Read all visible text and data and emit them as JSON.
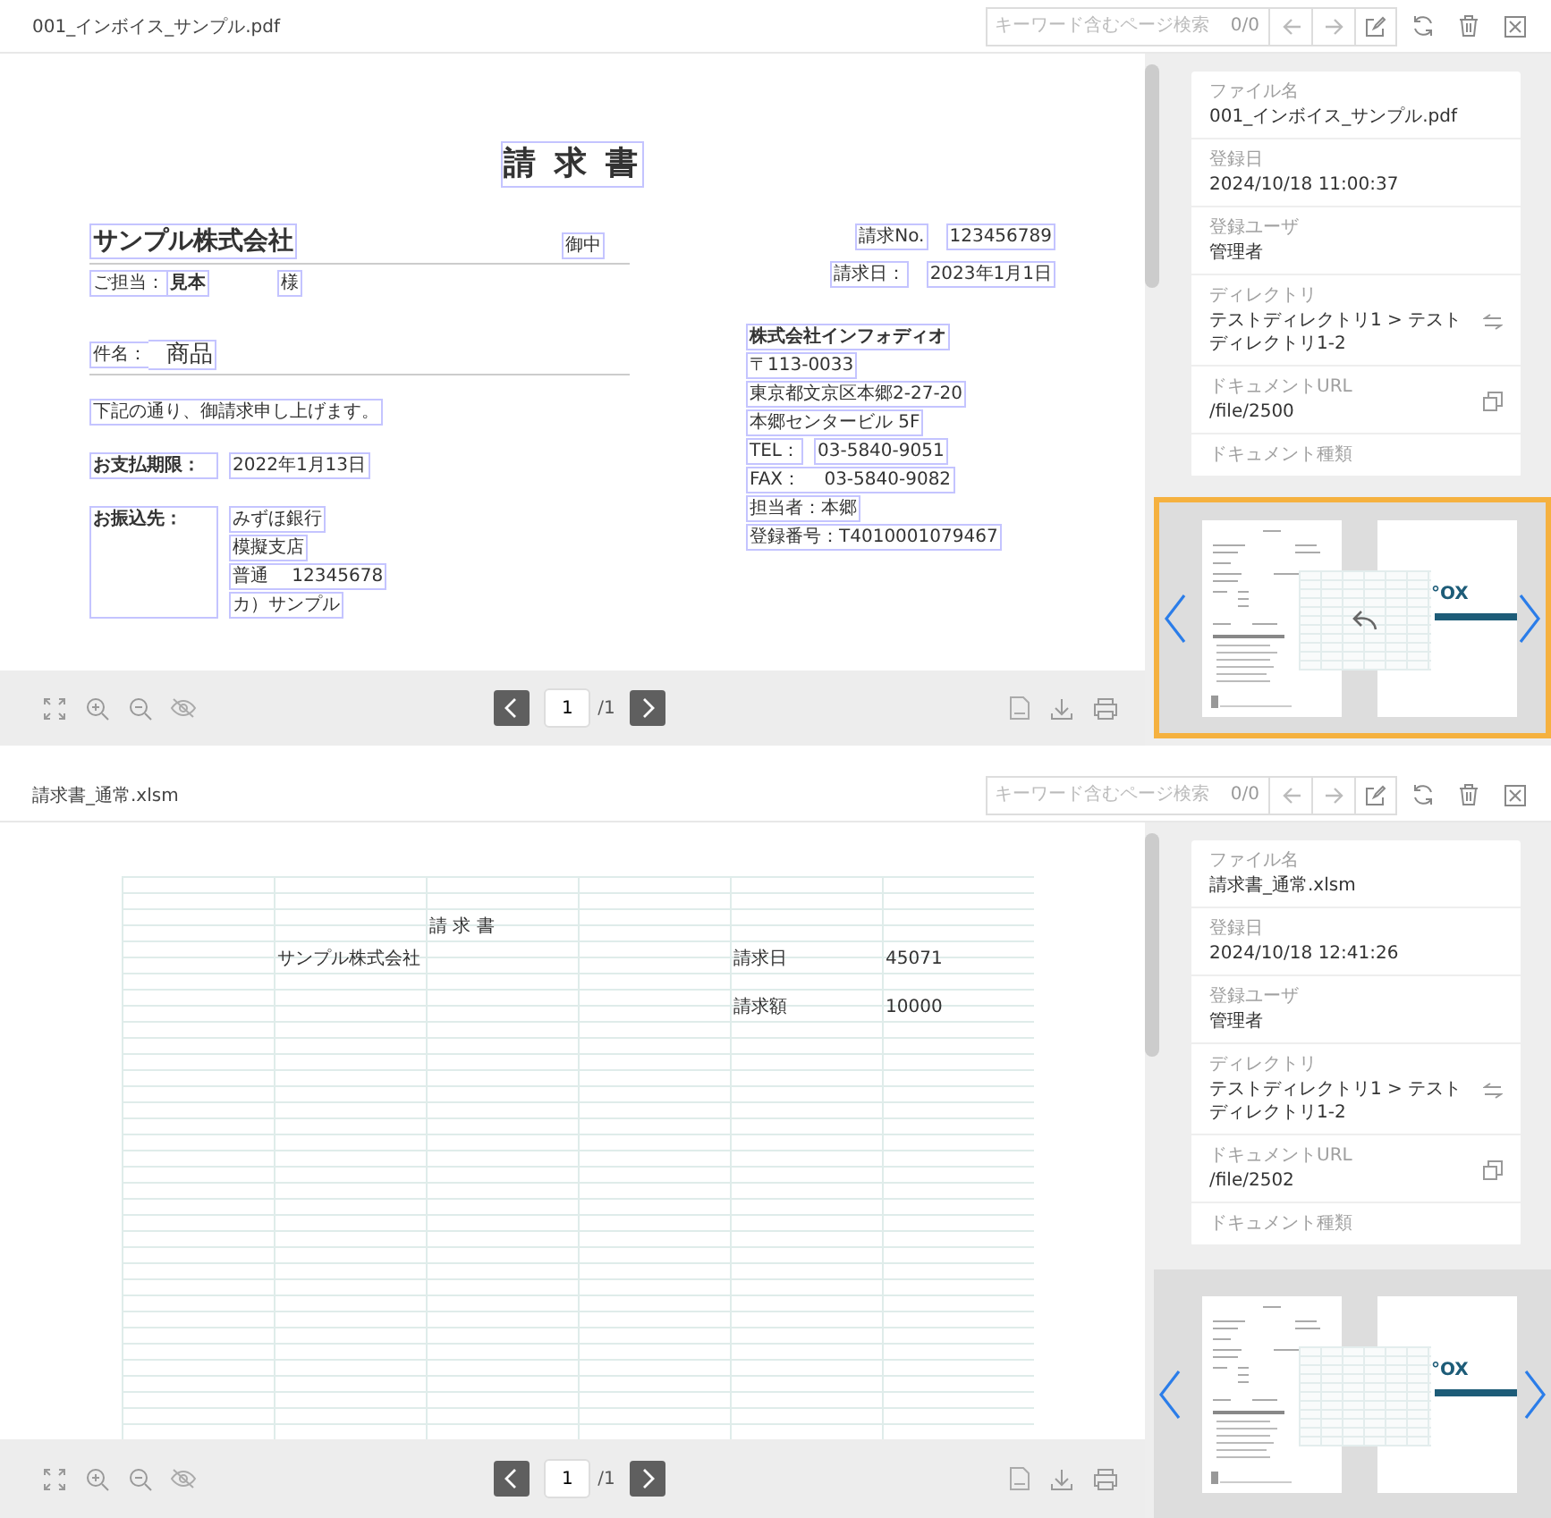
{
  "viewers": [
    {
      "file_name": "001_インボイス_サンプル.pdf",
      "search": {
        "placeholder": "キーワード含むページ検索",
        "count": "0/0"
      },
      "document": {
        "kind": "invoice",
        "title": "請 求 書",
        "recipient": "サンプル株式会社",
        "recipient_suffix": "御中",
        "contact_label": "ご担当：",
        "contact": "見本",
        "contact_suffix": "様",
        "subject_label": "件名：",
        "subject": "商品",
        "message": "下記の通り、御請求申し上げます。",
        "due_label": "お支払期限：",
        "due": "2022年1月13日",
        "bank_label": "お振込先：",
        "bank_lines": [
          "みずほ銀行",
          "模擬支店",
          "普通　 12345678",
          "カ）サンプル"
        ],
        "meta": [
          {
            "label": "請求No.",
            "value": "123456789"
          },
          {
            "label": "請求日：",
            "value": "2023年1月1日"
          }
        ],
        "issuer": [
          {
            "parts": [
              "株式会社インフォディオ"
            ],
            "bold": true
          },
          {
            "parts": [
              "〒113-0033"
            ],
            "bold": false
          },
          {
            "parts": [
              "東京都文京区本郷2-27-20"
            ],
            "bold": false
          },
          {
            "parts": [
              "本郷センタービル 5F"
            ],
            "bold": false
          },
          {
            "parts": [
              "TEL：",
              "03-5840-9051"
            ],
            "bold": false
          },
          {
            "parts": [
              "FAX：　 03-5840-9082"
            ],
            "bold": false
          },
          {
            "parts": [
              "担当者：本郷"
            ],
            "bold": false
          },
          {
            "parts": [
              "登録番号：T4010001079467"
            ],
            "bold": false
          }
        ]
      },
      "pager": {
        "page": "1",
        "total": "/1"
      },
      "details": [
        {
          "label": "ファイル名",
          "value": "001_インボイス_サンプル.pdf",
          "kind": "text"
        },
        {
          "label": "登録日",
          "value": "2024/10/18 11:00:37",
          "kind": "text"
        },
        {
          "label": "登録ユーザ",
          "value": "管理者",
          "kind": "text"
        },
        {
          "label": "ディレクトリ",
          "value": "テストディレクトリ1 > テストディレクトリ1-2",
          "kind": "directory"
        },
        {
          "label": "ドキュメントURL",
          "value": "/file/2500",
          "kind": "url"
        },
        {
          "label": "ドキュメント種類",
          "kind": "text"
        }
      ],
      "carousel": {
        "highlighted": true,
        "undo_overlay": true,
        "logo_text": "°OX"
      }
    },
    {
      "file_name": "請求書_通常.xlsm",
      "search": {
        "placeholder": "キーワード含むページ検索",
        "count": "0/0"
      },
      "document": {
        "kind": "sheet",
        "rows": [
          [
            null,
            null,
            "請 求 書",
            null,
            null,
            null
          ],
          [
            null,
            "サンプル株式会社",
            null,
            null,
            "請求日",
            "45071"
          ],
          [
            null,
            null,
            null,
            null,
            "請求額",
            "10000"
          ]
        ]
      },
      "pager": {
        "page": "1",
        "total": "/1"
      },
      "details": [
        {
          "label": "ファイル名",
          "value": "請求書_通常.xlsm",
          "kind": "text"
        },
        {
          "label": "登録日",
          "value": "2024/10/18 12:41:26",
          "kind": "text"
        },
        {
          "label": "登録ユーザ",
          "value": "管理者",
          "kind": "text"
        },
        {
          "label": "ディレクトリ",
          "value": "テストディレクトリ1 > テストディレクトリ1-2",
          "kind": "directory"
        },
        {
          "label": "ドキュメントURL",
          "value": "/file/2502",
          "kind": "url"
        },
        {
          "label": "ドキュメント種類",
          "kind": "text"
        }
      ],
      "carousel": {
        "highlighted": false,
        "undo_overlay": false,
        "logo_text": "°OX"
      }
    }
  ]
}
